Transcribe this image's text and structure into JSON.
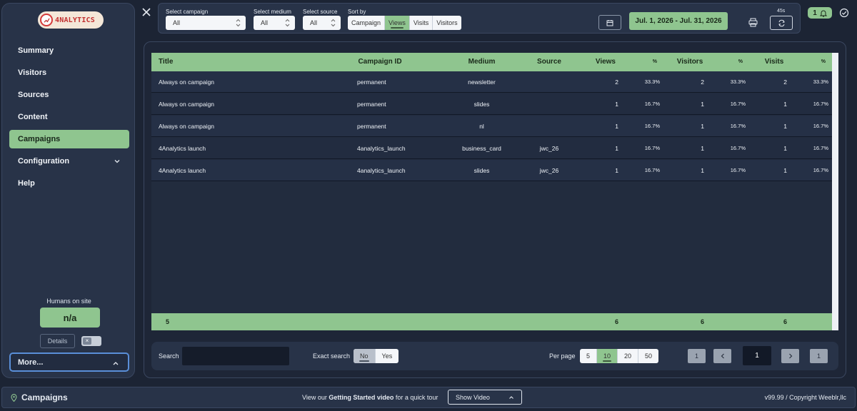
{
  "brand": {
    "name": "4NALYTICS"
  },
  "sidebar": {
    "items": [
      {
        "label": "Summary",
        "name": "sidebar-item-summary",
        "active": false
      },
      {
        "label": "Visitors",
        "name": "sidebar-item-visitors",
        "active": false
      },
      {
        "label": "Sources",
        "name": "sidebar-item-sources",
        "active": false
      },
      {
        "label": "Content",
        "name": "sidebar-item-content",
        "active": false
      },
      {
        "label": "Campaigns",
        "name": "sidebar-item-campaigns",
        "active": true
      },
      {
        "label": "Configuration",
        "name": "sidebar-item-configuration",
        "active": false,
        "expandable": true
      },
      {
        "label": "Help",
        "name": "sidebar-item-help",
        "active": false
      }
    ],
    "humans_label": "Humans on site",
    "humans_value": "n/a",
    "details_label": "Details",
    "more_label": "More..."
  },
  "filters": {
    "campaign": {
      "label": "Select campaign",
      "value": "All"
    },
    "medium": {
      "label": "Select medium",
      "value": "All"
    },
    "source": {
      "label": "Select source",
      "value": "All"
    },
    "sort": {
      "label": "Sort by",
      "options": [
        "Campaign",
        "Views",
        "Visits",
        "Visitors"
      ],
      "selected": "Views"
    },
    "date_range": "Jul. 1, 2026 - Jul. 31, 2026",
    "refresh_timer": "45s"
  },
  "notifications": {
    "count": "1"
  },
  "table": {
    "columns": [
      "Title",
      "Campaign ID",
      "Medium",
      "Source",
      "Views",
      "%",
      "Visitors",
      "%",
      "Visits",
      "%"
    ],
    "rows": [
      [
        "Always on campaign",
        "permanent",
        "newsletter",
        "",
        "2",
        "33.3%",
        "2",
        "33.3%",
        "2",
        "33.3%"
      ],
      [
        "Always on campaign",
        "permanent",
        "slides",
        "",
        "1",
        "16.7%",
        "1",
        "16.7%",
        "1",
        "16.7%"
      ],
      [
        "Always on campaign",
        "permanent",
        "nl",
        "",
        "1",
        "16.7%",
        "1",
        "16.7%",
        "1",
        "16.7%"
      ],
      [
        "4Analytics launch",
        "4analytics_launch",
        "business_card",
        "jwc_26",
        "1",
        "16.7%",
        "1",
        "16.7%",
        "1",
        "16.7%"
      ],
      [
        "4Analytics launch",
        "4analytics_launch",
        "slides",
        "jwc_26",
        "1",
        "16.7%",
        "1",
        "16.7%",
        "1",
        "16.7%"
      ]
    ],
    "totals": {
      "count": "5",
      "views": "6",
      "visitors": "6",
      "visits": "6"
    }
  },
  "controls": {
    "search_label": "Search",
    "search_value": "",
    "exact_label": "Exact search",
    "exact_options": [
      "No",
      "Yes"
    ],
    "exact_selected": "No",
    "per_page_label": "Per page",
    "per_page_options": [
      "5",
      "10",
      "20",
      "50"
    ],
    "per_page_selected": "10",
    "pagination": {
      "first": "1",
      "current": "1",
      "last": "1"
    }
  },
  "footer": {
    "page_title": "Campaigns",
    "tour_prefix": "View our ",
    "tour_link": "Getting Started video",
    "tour_suffix": " for a quick tour",
    "video_button": "Show Video",
    "version": "v99.99  /  Copyright Weeblr,llc"
  },
  "colors": {
    "accent": "#8fc58f",
    "background": "#1c2434",
    "panel": "#283348",
    "focus": "#5a8fd8"
  }
}
